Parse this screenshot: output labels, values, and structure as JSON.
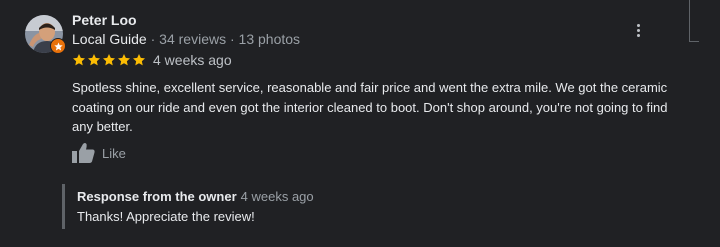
{
  "reviewer": {
    "name": "Peter Loo",
    "badge": "Local Guide",
    "separator": " · ",
    "reviews": "34 reviews",
    "photos": "13 photos",
    "avatar_icon": "user-avatar",
    "badge_icon": "local-guide-star-icon"
  },
  "rating": {
    "stars": 5,
    "max": 5,
    "star_color": "#fbbc04",
    "date": "4 weeks ago"
  },
  "review": {
    "text": "Spotless shine, excellent service, reasonable and fair price and went the extra mile.  We got the ceramic coating on our ride and even got the interior cleaned to boot. Don't shop around, you're not going to find any better."
  },
  "actions": {
    "like_label": "Like",
    "like_icon": "thumbs-up-icon",
    "more_icon": "more-vert-icon"
  },
  "owner_response": {
    "title": "Response from the owner",
    "date": "4 weeks ago",
    "text": "Thanks! Appreciate the review!"
  },
  "colors": {
    "background": "#202124",
    "text_primary": "#e8eaed",
    "text_secondary": "#9aa0a6",
    "guide_badge": "#e8710a",
    "star": "#fbbc04"
  }
}
